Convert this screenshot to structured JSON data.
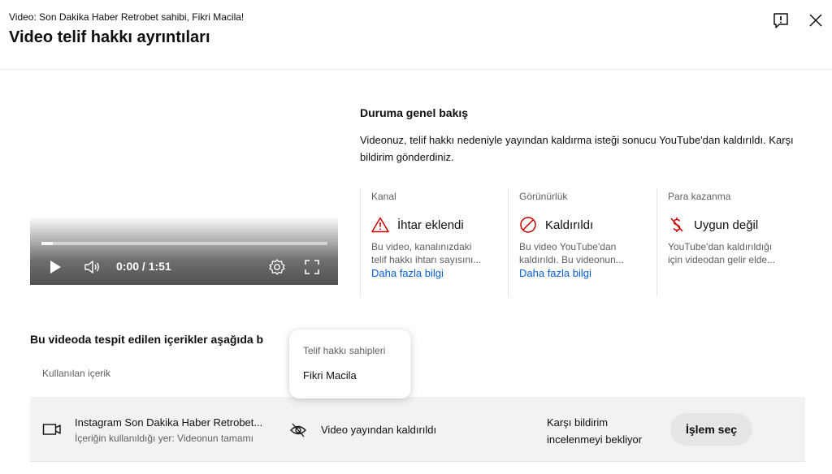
{
  "header": {
    "subtitle": "Video: Son Dakika Haber Retrobet sahibi, Fikri Macila!",
    "title": "Video telif hakkı ayrıntıları",
    "feedback_icon": "feedback-icon",
    "close_icon": "close-icon"
  },
  "player": {
    "time": "0:00 / 1:51",
    "progress_buffered": 0.04,
    "controls": [
      "play-icon",
      "volume-icon",
      "settings-icon",
      "fullscreen-icon"
    ]
  },
  "overview": {
    "title": "Duruma genel bakış",
    "description": "Videonuz, telif hakkı nedeniyle yayından kaldırma isteği sonucu YouTube'dan kaldırıldı. Karşı bildirim gönderdiniz.",
    "columns": [
      {
        "label": "Kanal",
        "icon": "warning-icon",
        "icon_color": "#cc0000",
        "status": "İhtar eklendi",
        "desc_line1": "Bu video, kanalınızdaki",
        "desc_line2": "telif hakkı ihtarı sayısını...",
        "link": "Daha fazla bilgi"
      },
      {
        "label": "Görünürlük",
        "icon": "blocked-icon",
        "icon_color": "#cc0000",
        "status": "Kaldırıldı",
        "desc_line1": "Bu video YouTube'dan",
        "desc_line2": "kaldırıldı. Bu videonun...",
        "link": "Daha fazla bilgi"
      },
      {
        "label": "Para kazanma",
        "icon": "no-money-icon",
        "icon_color": "#cc0000",
        "status": "Uygun değil",
        "desc_line1": "YouTube'dan kaldırıldığı",
        "desc_line2": "için videodan gelir elde...",
        "link": ""
      }
    ]
  },
  "detected": {
    "title": "Bu videoda tespit edilen içerikler aşağıda b",
    "column_header": "Kullanılan içerik",
    "rows": [
      {
        "icon": "video-icon",
        "title": "Instagram Son Dakika Haber Retrobet...",
        "subtitle": "İçeriğin kullanıldığı yer: Videonun tamamı",
        "visibility_icon": "hidden-eye-icon",
        "visibility": "Video yayından kaldırıldı",
        "status": "Karşı bildirim incelenmeyi bekliyor",
        "action": "İşlem seç"
      }
    ]
  },
  "tooltip": {
    "label": "Telif hakkı sahipleri",
    "value": "Fikri Macila"
  },
  "colors": {
    "link": "#065fd4",
    "alert": "#cc0000",
    "row_bg": "#f2f2f2",
    "button_bg": "#e5e5e5"
  }
}
